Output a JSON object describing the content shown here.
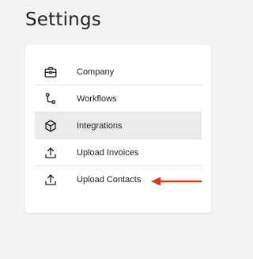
{
  "page": {
    "title": "Settings"
  },
  "menu": {
    "items": [
      {
        "label": "Company",
        "icon": "briefcase-icon"
      },
      {
        "label": "Workflows",
        "icon": "git-branch-icon"
      },
      {
        "label": "Integrations",
        "icon": "cube-icon",
        "active": true
      },
      {
        "label": "Upload Invoices",
        "icon": "upload-icon"
      },
      {
        "label": "Upload Contacts",
        "icon": "upload-icon"
      }
    ]
  },
  "colors": {
    "annotation_arrow": "#e8321e",
    "active_row": "#ebebeb"
  },
  "annotation": {
    "type": "arrow",
    "points_to": "Upload Contacts"
  }
}
